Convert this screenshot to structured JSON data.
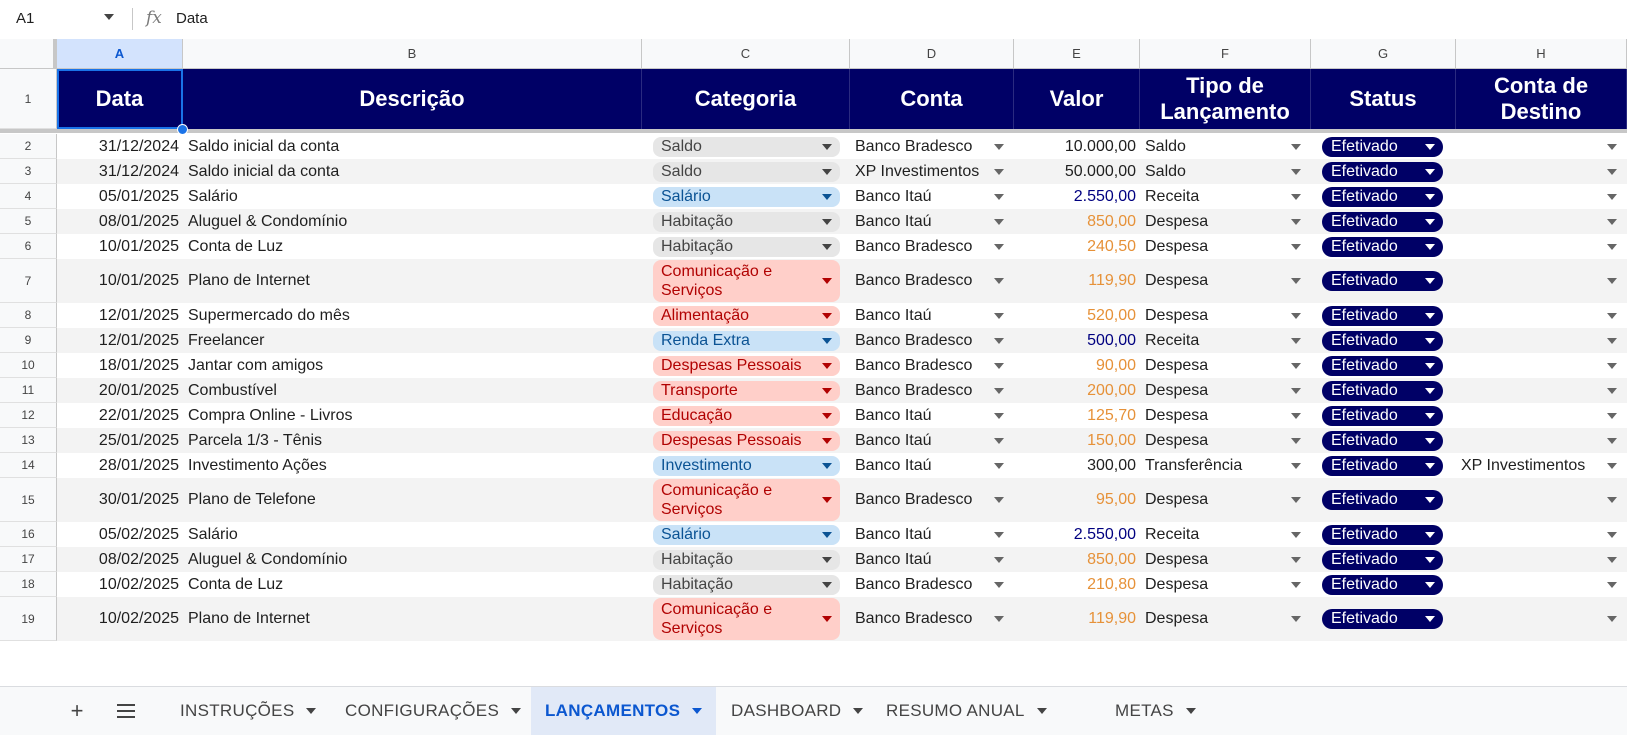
{
  "formula_bar": {
    "cell_ref": "A1",
    "fx": "fx",
    "content": "Data"
  },
  "columns": [
    "A",
    "B",
    "C",
    "D",
    "E",
    "F",
    "G",
    "H"
  ],
  "headers": [
    "Data",
    "Descrição",
    "Categoria",
    "Conta",
    "Valor",
    "Tipo de Lançamento",
    "Status",
    "Conta de Destino"
  ],
  "rows": [
    {
      "num": "1"
    },
    {
      "num": "2",
      "date": "31/12/2024",
      "desc": "Saldo inicial da conta",
      "cat": "Saldo",
      "cat_style": "gray",
      "conta": "Banco Bradesco",
      "valor": "10.000,00",
      "valor_style": "black",
      "tipo": "Saldo",
      "status": "Efetivado",
      "dest": ""
    },
    {
      "num": "3",
      "date": "31/12/2024",
      "desc": "Saldo inicial da conta",
      "cat": "Saldo",
      "cat_style": "gray",
      "conta": "XP Investimentos",
      "valor": "50.000,00",
      "valor_style": "black",
      "tipo": "Saldo",
      "status": "Efetivado",
      "dest": ""
    },
    {
      "num": "4",
      "date": "05/01/2025",
      "desc": "Salário",
      "cat": "Salário",
      "cat_style": "blue",
      "conta": "Banco Itaú",
      "valor": "2.550,00",
      "valor_style": "blue",
      "tipo": "Receita",
      "status": "Efetivado",
      "dest": ""
    },
    {
      "num": "5",
      "date": "08/01/2025",
      "desc": "Aluguel & Condomínio",
      "cat": "Habitação",
      "cat_style": "gray",
      "conta": "Banco Itaú",
      "valor": "850,00",
      "valor_style": "orange",
      "tipo": "Despesa",
      "status": "Efetivado",
      "dest": ""
    },
    {
      "num": "6",
      "date": "10/01/2025",
      "desc": "Conta de Luz",
      "cat": "Habitação",
      "cat_style": "gray",
      "conta": "Banco Bradesco",
      "valor": "240,50",
      "valor_style": "orange",
      "tipo": "Despesa",
      "status": "Efetivado",
      "dest": ""
    },
    {
      "num": "7",
      "date": "10/01/2025",
      "desc": "Plano de Internet",
      "cat": "Comunicação e Serviços",
      "cat_style": "red",
      "conta": "Banco Bradesco",
      "valor": "119,90",
      "valor_style": "orange",
      "tipo": "Despesa",
      "status": "Efetivado",
      "dest": ""
    },
    {
      "num": "8",
      "date": "12/01/2025",
      "desc": "Supermercado do mês",
      "cat": "Alimentação",
      "cat_style": "red",
      "conta": "Banco Itaú",
      "valor": "520,00",
      "valor_style": "orange",
      "tipo": "Despesa",
      "status": "Efetivado",
      "dest": ""
    },
    {
      "num": "9",
      "date": "12/01/2025",
      "desc": "Freelancer",
      "cat": "Renda Extra",
      "cat_style": "blue",
      "conta": "Banco Bradesco",
      "valor": "500,00",
      "valor_style": "blue",
      "tipo": "Receita",
      "status": "Efetivado",
      "dest": ""
    },
    {
      "num": "10",
      "date": "18/01/2025",
      "desc": "Jantar com amigos",
      "cat": "Despesas Pessoais",
      "cat_style": "red",
      "conta": "Banco Bradesco",
      "valor": "90,00",
      "valor_style": "orange",
      "tipo": "Despesa",
      "status": "Efetivado",
      "dest": ""
    },
    {
      "num": "11",
      "date": "20/01/2025",
      "desc": "Combustível",
      "cat": "Transporte",
      "cat_style": "red",
      "conta": "Banco Bradesco",
      "valor": "200,00",
      "valor_style": "orange",
      "tipo": "Despesa",
      "status": "Efetivado",
      "dest": ""
    },
    {
      "num": "12",
      "date": "22/01/2025",
      "desc": "Compra Online - Livros",
      "cat": "Educação",
      "cat_style": "red",
      "conta": "Banco Itaú",
      "valor": "125,70",
      "valor_style": "orange",
      "tipo": "Despesa",
      "status": "Efetivado",
      "dest": ""
    },
    {
      "num": "13",
      "date": "25/01/2025",
      "desc": "Parcela 1/3 - Tênis",
      "cat": "Despesas Pessoais",
      "cat_style": "red",
      "conta": "Banco Itaú",
      "valor": "150,00",
      "valor_style": "orange",
      "tipo": "Despesa",
      "status": "Efetivado",
      "dest": ""
    },
    {
      "num": "14",
      "date": "28/01/2025",
      "desc": "Investimento Ações",
      "cat": "Investimento",
      "cat_style": "blue",
      "conta": "Banco Itaú",
      "valor": "300,00",
      "valor_style": "black",
      "tipo": "Transferência",
      "status": "Efetivado",
      "dest": "XP Investimentos"
    },
    {
      "num": "15",
      "date": "30/01/2025",
      "desc": "Plano de Telefone",
      "cat": "Comunicação e Serviços",
      "cat_style": "red",
      "conta": "Banco Bradesco",
      "valor": "95,00",
      "valor_style": "orange",
      "tipo": "Despesa",
      "status": "Efetivado",
      "dest": ""
    },
    {
      "num": "16",
      "date": "05/02/2025",
      "desc": "Salário",
      "cat": "Salário",
      "cat_style": "blue",
      "conta": "Banco Itaú",
      "valor": "2.550,00",
      "valor_style": "blue",
      "tipo": "Receita",
      "status": "Efetivado",
      "dest": ""
    },
    {
      "num": "17",
      "date": "08/02/2025",
      "desc": "Aluguel & Condomínio",
      "cat": "Habitação",
      "cat_style": "gray",
      "conta": "Banco Itaú",
      "valor": "850,00",
      "valor_style": "orange",
      "tipo": "Despesa",
      "status": "Efetivado",
      "dest": ""
    },
    {
      "num": "18",
      "date": "10/02/2025",
      "desc": "Conta de Luz",
      "cat": "Habitação",
      "cat_style": "gray",
      "conta": "Banco Bradesco",
      "valor": "210,80",
      "valor_style": "orange",
      "tipo": "Despesa",
      "status": "Efetivado",
      "dest": ""
    },
    {
      "num": "19",
      "date": "10/02/2025",
      "desc": "Plano de Internet",
      "cat": "Comunicação e Serviços",
      "cat_style": "red",
      "conta": "Banco Bradesco",
      "valor": "119,90",
      "valor_style": "orange",
      "tipo": "Despesa",
      "status": "Efetivado",
      "dest": ""
    }
  ],
  "sheet_tabs": {
    "add_icon": "plus-icon",
    "menu_icon": "menu-icon",
    "active": "LANÇAMENTOS",
    "tabs": [
      "INSTRUÇÕES",
      "CONFIGURAÇÕES",
      "LANÇAMENTOS",
      "DASHBOARD",
      "RESUMO ANUAL",
      "METAS"
    ]
  },
  "colors": {
    "header_bg": "#000066",
    "status_bg": "#000066",
    "income": "#000080",
    "expense": "#e69138",
    "chip_gray": "#e6e6e6",
    "chip_blue": "#c9e2f7",
    "chip_red": "#ffcfc9",
    "selection": "#1a73e8"
  }
}
